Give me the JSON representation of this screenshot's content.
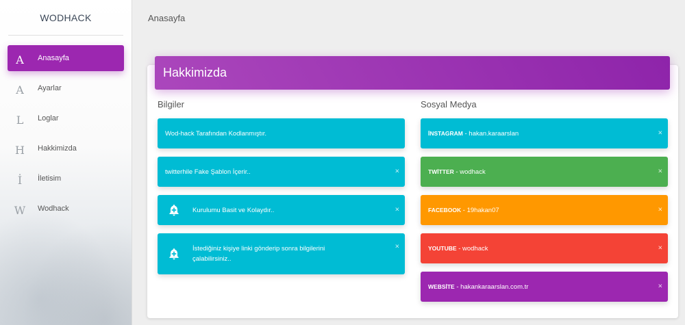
{
  "sidebar": {
    "brand": "WODHACK",
    "items": [
      {
        "letter": "A",
        "label": "Anasayfa",
        "active": true
      },
      {
        "letter": "A",
        "label": "Ayarlar"
      },
      {
        "letter": "L",
        "label": "Loglar"
      },
      {
        "letter": "H",
        "label": "Hakkimizda"
      },
      {
        "letter": "İ",
        "label": "İletisim"
      },
      {
        "letter": "W",
        "label": "Wodhack"
      }
    ]
  },
  "topbar": {
    "title": "Anasayfa"
  },
  "card": {
    "title": "Hakkimizda"
  },
  "bilgiler": {
    "title": "Bilgiler",
    "alerts": [
      {
        "text": "Wod-hack Tarafından Kodlanmıştır."
      },
      {
        "text": "twitterhile Fake Şablon İçerir..",
        "close": "×"
      },
      {
        "text": "Kurulumu Basit ve Kolaydır..",
        "close": "×",
        "icon": "bell-plus-icon"
      },
      {
        "text_line1": "İstediğiniz kişiye linki gönderip sonra bilgilerini",
        "text_line2": "çalabilirsiniz..",
        "close": "×",
        "icon": "bell-plus-icon"
      }
    ]
  },
  "sosyal": {
    "title": "Sosyal Medya",
    "alerts": [
      {
        "label": "İNSTAGRAM",
        "value": " - hakan.karaarslan",
        "close": "×",
        "color": "#00bcd4"
      },
      {
        "label": "TWİTTER",
        "value": " - wodhack",
        "close": "×",
        "color": "#4caf50"
      },
      {
        "label": "FACEBOOK",
        "value": " - 19hakan07",
        "close": "×",
        "color": "#ff9800"
      },
      {
        "label": "YOUTUBE",
        "value": " - wodhack",
        "close": "×",
        "color": "#f44336"
      },
      {
        "label": "WEBSİTE",
        "value": " - hakankaraarslan.com.tr",
        "close": "×",
        "color": "#9c27b0"
      }
    ]
  },
  "colors": {
    "accent": "#9c27b0",
    "info": "#00bcd4"
  }
}
